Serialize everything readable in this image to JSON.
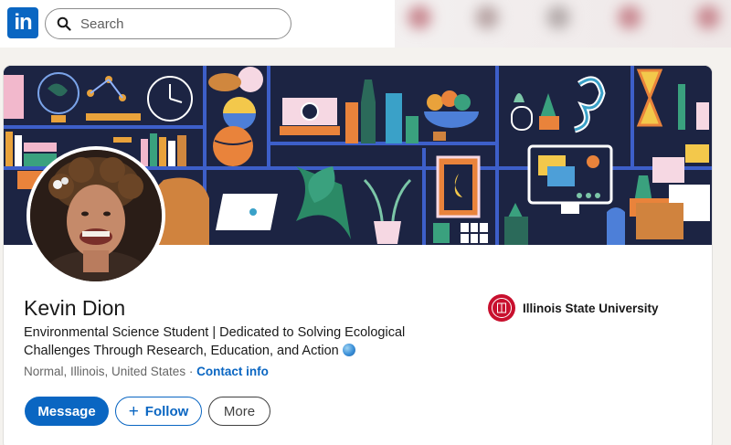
{
  "nav": {
    "logo_text": "in",
    "search_placeholder": "Search"
  },
  "profile": {
    "name": "Kevin Dion",
    "headline": "Environmental Science Student | Dedicated to Solving Ecological Challenges Through Research, Education, and Action",
    "location": "Normal, Illinois, United States",
    "separator": "·",
    "contact_link": "Contact info",
    "education": "Illinois State University"
  },
  "actions": {
    "message": "Message",
    "follow": "Follow",
    "more": "More"
  },
  "colors": {
    "brand": "#0a66c2",
    "banner_bg": "#1b2340",
    "university_red": "#c8102e"
  },
  "icons": {
    "search": "search-icon",
    "globe": "globe-emoji-icon",
    "plus": "plus-icon",
    "university_seal": "university-seal-icon"
  }
}
